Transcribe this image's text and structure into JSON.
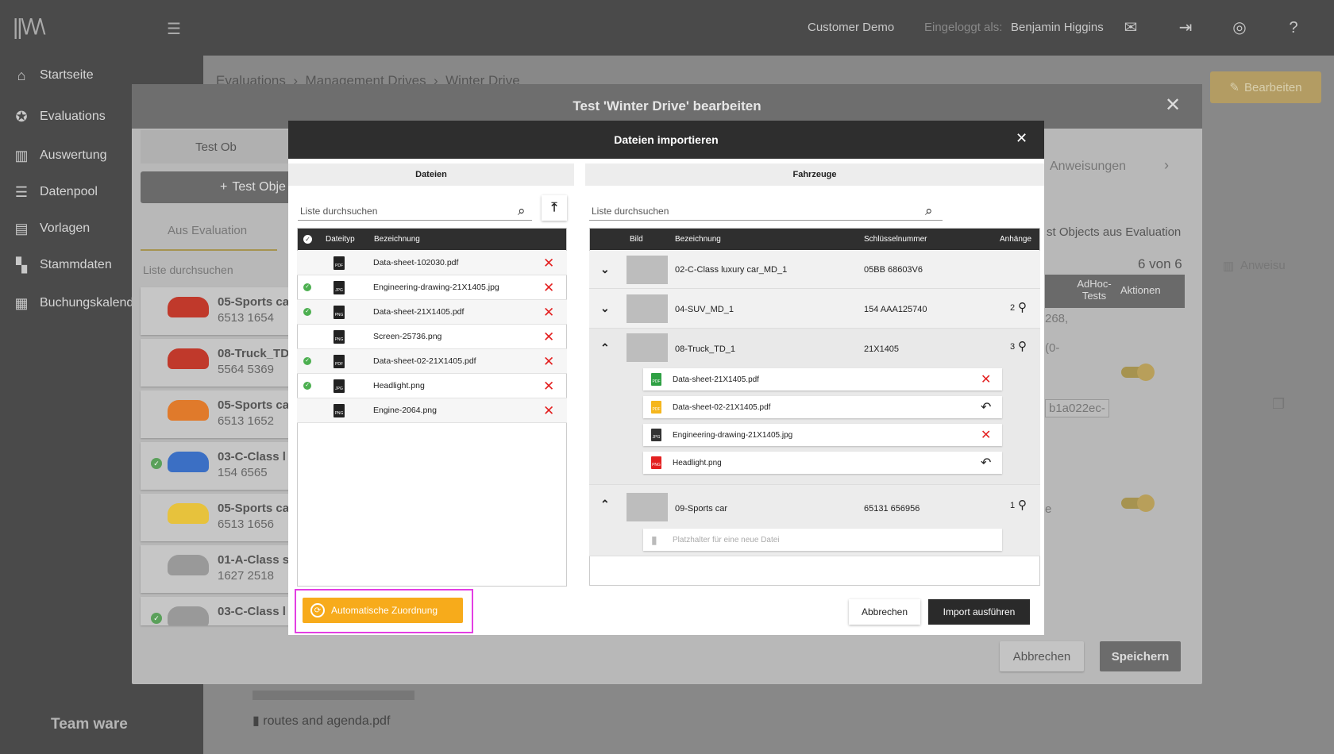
{
  "topbar": {
    "logo": "||\\/\\/\\",
    "customer": "Customer Demo",
    "logged_in_label": "Eingeloggt als:",
    "user_name": "Benjamin Higgins"
  },
  "sidebar": {
    "items": [
      {
        "label": "Startseite",
        "icon": "home-icon"
      },
      {
        "label": "Evaluations",
        "icon": "star-icon"
      },
      {
        "label": "Auswertung",
        "icon": "chart-icon"
      },
      {
        "label": "Datenpool",
        "icon": "list-icon"
      },
      {
        "label": "Vorlagen",
        "icon": "template-icon"
      },
      {
        "label": "Stammdaten",
        "icon": "tree-icon"
      },
      {
        "label": "Buchungskalender",
        "icon": "calendar-icon"
      }
    ],
    "brand": "Team ware"
  },
  "breadcrumb": [
    "Evaluations",
    "Management Drives",
    "Winter Drive"
  ],
  "base_edit_label": "Bearbeiten",
  "edit_dialog": {
    "title": "Test 'Winter Drive' bearbeiten",
    "tab_left": "Test Ob",
    "add_button": "Test Obje",
    "tab_from_eval": "Aus Evaluation",
    "search_placeholder": "Liste durchsuchen",
    "vehicles": [
      {
        "name": "05-Sports ca",
        "num": "6513 1654",
        "color": "#c0392b",
        "checked": false
      },
      {
        "name": "08-Truck_TD",
        "num": "5564 5369",
        "color": "#c0392b",
        "checked": false
      },
      {
        "name": "05-Sports ca",
        "num": "6513 1652",
        "color": "#e07a2b",
        "checked": false
      },
      {
        "name": "03-C-Class l",
        "num": "154 6565",
        "color": "#3b6fc4",
        "checked": true
      },
      {
        "name": "05-Sports ca",
        "num": "6513 1656",
        "color": "#e7c23c",
        "checked": false
      },
      {
        "name": "01-A-Class s",
        "num": "1627 2518",
        "color": "#999999",
        "checked": false
      },
      {
        "name": "03-C-Class l",
        "num": "",
        "color": "#999999",
        "checked": true
      }
    ],
    "right_tab": "Anweisungen",
    "right_btn": "st Objects aus Evaluation",
    "count_text": "6 von 6",
    "right_tab2": "Anweisu",
    "th_adhoc": "AdHoc-\nTests",
    "th_actions": "Aktionen",
    "frag1": "268,",
    "frag2": "(0-",
    "frag3": "b1a022ec-",
    "frag4": "e",
    "cancel": "Abbrechen",
    "save": "Speichern",
    "attachment": "routes and agenda.pdf"
  },
  "import_dialog": {
    "title": "Dateien importieren",
    "files_header": "Dateien",
    "vehicles_header": "Fahrzeuge",
    "search_placeholder": "Liste durchsuchen",
    "file_columns": [
      "Dateityp",
      "Bezeichnung"
    ],
    "files": [
      {
        "name": "Data-sheet-102030.pdf",
        "type": "PDF",
        "checked": false
      },
      {
        "name": "Engineering-drawing-21X1405.jpg",
        "type": "JPG",
        "checked": true
      },
      {
        "name": "Data-sheet-21X1405.pdf",
        "type": "PNG",
        "checked": true
      },
      {
        "name": "Screen-25736.png",
        "type": "PNG",
        "checked": false
      },
      {
        "name": "Data-sheet-02-21X1405.pdf",
        "type": "PDF",
        "checked": true
      },
      {
        "name": "Headlight.png",
        "type": "JPG",
        "checked": true
      },
      {
        "name": "Engine-2064.png",
        "type": "PNG",
        "checked": false
      }
    ],
    "vehicle_columns": [
      "Bild",
      "Bezeichnung",
      "Schlüsselnummer",
      "Anhänge"
    ],
    "vehicles": [
      {
        "name": "02-C-Class luxury car_MD_1",
        "key": "05BB 68603V6",
        "count": "",
        "expanded": false
      },
      {
        "name": "04-SUV_MD_1",
        "key": "154 AAA125740",
        "count": "2",
        "expanded": false
      },
      {
        "name": "08-Truck_TD_1",
        "key": "21X1405",
        "count": "3",
        "expanded": true
      },
      {
        "name": "09-Sports car",
        "key": "65131 656956",
        "count": "1",
        "expanded": true
      }
    ],
    "truck_attachments": [
      {
        "name": "Data-sheet-21X1405.pdf",
        "type": "PDF",
        "color": "#2ea043",
        "action": "delete"
      },
      {
        "name": "Data-sheet-02-21X1405.pdf",
        "type": "PDF",
        "color": "#f5b61d",
        "action": "undo"
      },
      {
        "name": "Engineering-drawing-21X1405.jpg",
        "type": "JPG",
        "color": "#333333",
        "action": "delete"
      },
      {
        "name": "Headlight.png",
        "type": "PNG",
        "color": "#e32020",
        "action": "undo"
      }
    ],
    "placeholder_file": "Platzhalter für eine neue Datei",
    "auto_assign": "Automatische Zuordnung",
    "cancel": "Abbrechen",
    "run_import": "Import ausführen"
  },
  "colors": {
    "accent": "#f7ab1b",
    "delete": "#e32020",
    "check": "#4caf50",
    "highlight": "#e33ee3"
  }
}
